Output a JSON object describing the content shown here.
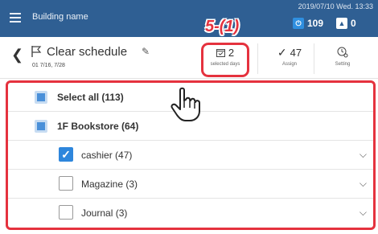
{
  "header": {
    "building_name": "Building name",
    "datetime": "2019/07/10 Wed. 13:33",
    "power_count": "109",
    "alert_count": "0",
    "power_icon": "power-icon",
    "alert_icon": "alert-icon"
  },
  "annotation": {
    "step": "5-(1)"
  },
  "schedule": {
    "title": "Clear schedule",
    "dates": "01  7/16, 7/28"
  },
  "toolbar": {
    "selected_days_count": "2",
    "selected_days_label": "selected days",
    "assign_count": "47",
    "assign_label": "Assign",
    "setting_label": "Setting"
  },
  "list": {
    "select_all": "Select all (113)",
    "group": "1F Bookstore (64)",
    "items": [
      {
        "label": "cashier (47)",
        "checked": true
      },
      {
        "label": "Magazine (3)",
        "checked": false
      },
      {
        "label": "Journal (3)",
        "checked": false
      }
    ]
  },
  "colors": {
    "header_bg": "#2f5f93",
    "highlight": "#e5323e",
    "checkbox_blue": "#2e86dc"
  }
}
